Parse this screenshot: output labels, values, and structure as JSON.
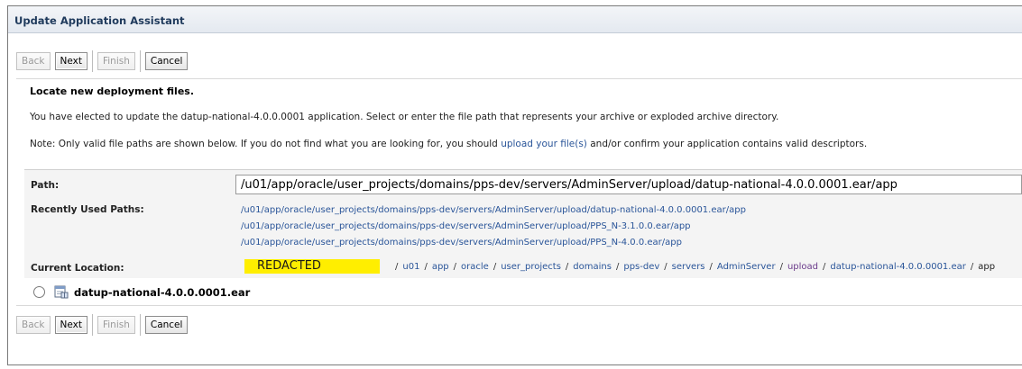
{
  "window": {
    "title": "Update Application Assistant"
  },
  "toolbar": {
    "back_label": "Back",
    "next_label": "Next",
    "finish_label": "Finish",
    "cancel_label": "Cancel"
  },
  "content": {
    "heading": "Locate new deployment files.",
    "intro": "You have elected to update the datup-national-4.0.0.0001 application. Select or enter the file path that represents your archive or exploded archive directory.",
    "note_prefix": "Note: Only valid file paths are shown below. If you do not find what you are looking for, you should ",
    "note_link": "upload your file(s)",
    "note_suffix": " and/or confirm your application contains valid descriptors."
  },
  "path_form": {
    "path_label": "Path:",
    "path_value": "/u01/app/oracle/user_projects/domains/pps-dev/servers/AdminServer/upload/datup-national-4.0.0.0001.ear/app",
    "recent_label": "Recently Used Paths:",
    "recent_paths": [
      "/u01/app/oracle/user_projects/domains/pps-dev/servers/AdminServer/upload/datup-national-4.0.0.0001.ear/app",
      "/u01/app/oracle/user_projects/domains/pps-dev/servers/AdminServer/upload/PPS_N-3.1.0.0.ear/app",
      "/u01/app/oracle/user_projects/domains/pps-dev/servers/AdminServer/upload/PPS_N-4.0.0.ear/app"
    ],
    "current_location_label": "Current Location:",
    "redacted_text": "REDACTED",
    "crumbs": [
      "u01",
      "app",
      "oracle",
      "user_projects",
      "domains",
      "pps-dev",
      "servers",
      "AdminServer",
      "upload",
      "datup-national-4.0.0.0001.ear"
    ],
    "crumb_current": "app"
  },
  "file_list": {
    "ear_name": "datup-national-4.0.0.0001.ear"
  },
  "colors": {
    "link": "#2a5599",
    "visited_link": "#6a3a8a",
    "redaction": "#ffee00"
  }
}
